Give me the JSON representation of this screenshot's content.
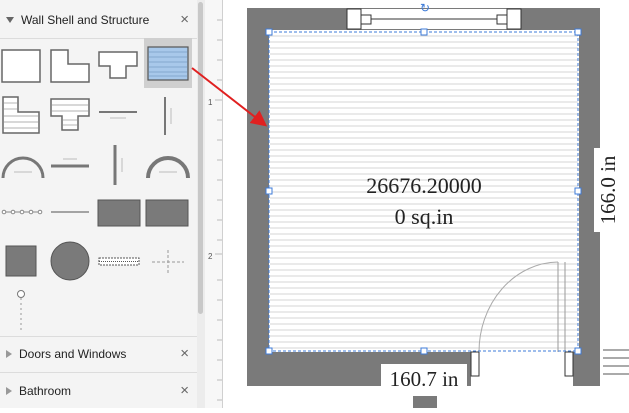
{
  "library": {
    "sections": [
      {
        "title": "Wall Shell and Structure",
        "expanded": true,
        "close_glyph": "×"
      },
      {
        "title": "Doors and Windows",
        "expanded": false,
        "close_glyph": "×"
      },
      {
        "title": "Bathroom",
        "expanded": false,
        "close_glyph": "×"
      }
    ]
  },
  "ruler": {
    "marks": [
      "1",
      "2"
    ]
  },
  "canvas": {
    "room": {
      "area_value": "26676.20000",
      "area_unit": "0 sq.in",
      "width_dimension": "160.7 in",
      "height_dimension": "166.0 in"
    },
    "rotate_glyph": "↻"
  },
  "colors": {
    "wall": "#7a7a7a",
    "selection": "#3d7bd8",
    "arrow": "#e02020",
    "selected_shape_fill": "#a8c8ea"
  }
}
